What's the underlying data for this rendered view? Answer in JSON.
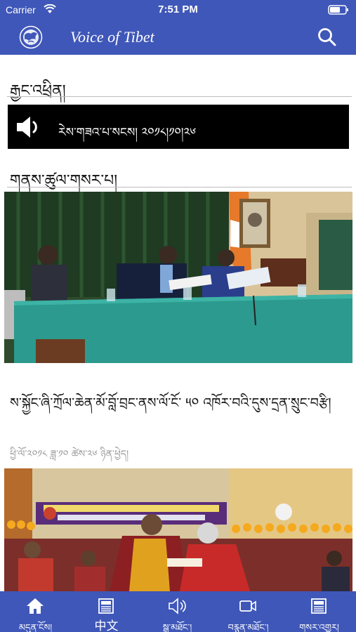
{
  "status_bar": {
    "carrier": "Carrier",
    "time": "7:51 PM"
  },
  "nav": {
    "title": "Voice of Tibet"
  },
  "sections": {
    "news_heading": "རྒྱང་འཕྲིན།",
    "audio_label": "རེས་གཟའ་པ་སངས། ༢༠༡༨།༡༠།༢༦",
    "info_heading": "གནས་ཚུལ་གསར་པ།"
  },
  "article": {
    "title": "ས་སྐྱོང་ཞི་ཀྲོལ་ཆེན་མོ་བློ་བྲང་ནས་ལོ་ངོ་ ༥༠ འཁོར་བའི་དུས་དྲན་སྲུང་བརྩི།",
    "date": "ཕྱི་ལོ་༢༠༡༨ ཟླ་༡༠ ཚེས་༢༦ ཉིན་ཕྱེད།"
  },
  "tabs": [
    {
      "label": "མདུན་ངོས།",
      "icon": "home-icon"
    },
    {
      "label": "中文",
      "icon": "newspaper-icon"
    },
    {
      "label": "སྒྲ་མཐོང་།",
      "icon": "speaker-icon"
    },
    {
      "label": "བརྙན་མཐོང་།",
      "icon": "video-icon"
    },
    {
      "label": "གསར་འགྱུར།",
      "icon": "newspaper-icon"
    }
  ],
  "colors": {
    "brand": "#3f57b8",
    "text": "#111111",
    "muted": "#9a9a9a",
    "audio_bg": "#000000"
  }
}
